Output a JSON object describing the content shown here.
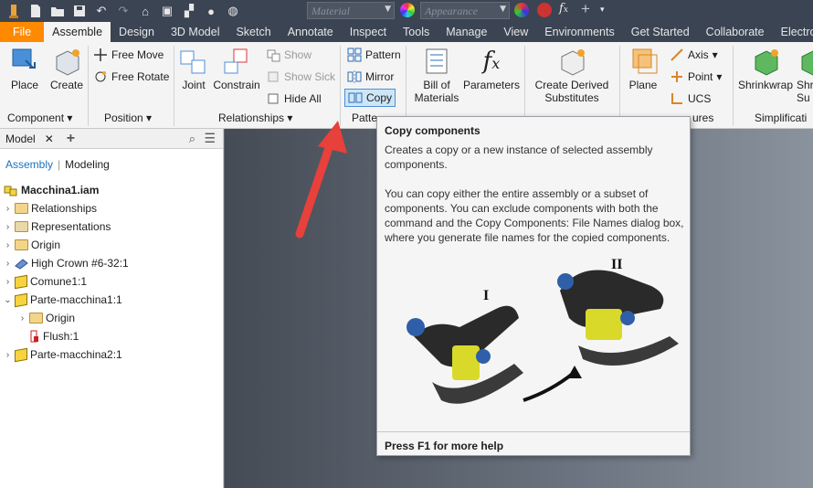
{
  "qab": {
    "material_placeholder": "Material",
    "appearance_placeholder": "Appearance"
  },
  "tabs": [
    "File",
    "Assemble",
    "Design",
    "3D Model",
    "Sketch",
    "Annotate",
    "Inspect",
    "Tools",
    "Manage",
    "View",
    "Environments",
    "Get Started",
    "Collaborate",
    "Electrom"
  ],
  "ribbon": {
    "place": "Place",
    "create": "Create",
    "free_move": "Free Move",
    "free_rotate": "Free Rotate",
    "joint": "Joint",
    "constrain": "Constrain",
    "show": "Show",
    "show_sick": "Show Sick",
    "hide_all": "Hide All",
    "pattern": "Pattern",
    "mirror": "Mirror",
    "copy": "Copy",
    "bom_line1": "Bill of",
    "bom_line2": "Materials",
    "parameters": "Parameters",
    "derived_line1": "Create Derived",
    "derived_line2": "Substitutes",
    "plane": "Plane",
    "axis": "Axis",
    "point": "Point",
    "ucs": "UCS",
    "shrinkwrap": "Shrinkwrap",
    "shr2": "Shr",
    "shr2b": "Su",
    "panels": {
      "component": "Component",
      "position": "Position",
      "relationships": "Relationships",
      "pattern": "Patte",
      "features": "ures",
      "simplification": "Simplificati"
    }
  },
  "browser": {
    "title": "Model",
    "tab_assembly": "Assembly",
    "tab_modeling": "Modeling",
    "root": "Macchina1.iam",
    "items": [
      {
        "label": "Relationships"
      },
      {
        "label": "Representations"
      },
      {
        "label": "Origin"
      },
      {
        "label": "High Crown #6-32:1"
      },
      {
        "label": "Comune1:1"
      },
      {
        "label": "Parte-macchina1:1"
      },
      {
        "label": "Origin"
      },
      {
        "label": "Flush:1"
      },
      {
        "label": "Parte-macchina2:1"
      }
    ]
  },
  "tooltip": {
    "title": "Copy components",
    "para1": "Creates a copy or a new instance of selected assembly components.",
    "para2": "You can copy either the entire assembly or a subset of components. You can exclude components with both the command and the Copy Components: File Names dialog box, where you generate file names for the copied components.",
    "label_i": "I",
    "label_ii": "II",
    "footer": "Press F1 for more help"
  },
  "colors": {
    "file_tab": "#ff8a00",
    "arrow": "#e8403a",
    "accent_link": "#1a72c0"
  }
}
